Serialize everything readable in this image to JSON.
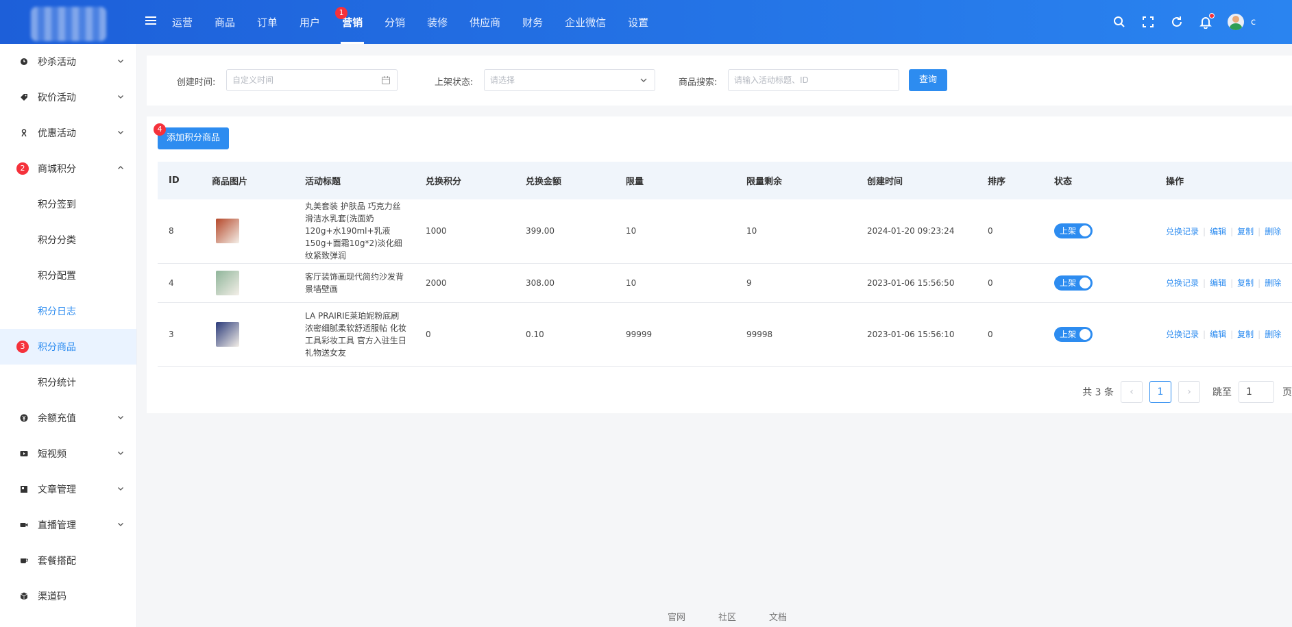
{
  "topbar": {
    "username": "c",
    "nav": [
      {
        "label": "运营",
        "active": false
      },
      {
        "label": "商品",
        "active": false
      },
      {
        "label": "订单",
        "active": false
      },
      {
        "label": "用户",
        "active": false
      },
      {
        "label": "营销",
        "active": true,
        "badge": "1"
      },
      {
        "label": "分销",
        "active": false
      },
      {
        "label": "装修",
        "active": false
      },
      {
        "label": "供应商",
        "active": false
      },
      {
        "label": "财务",
        "active": false
      },
      {
        "label": "企业微信",
        "active": false
      },
      {
        "label": "设置",
        "active": false
      }
    ]
  },
  "sidebar": {
    "items": [
      {
        "label": "秒杀活动",
        "icon": "clock-icon",
        "expandable": true
      },
      {
        "label": "砍价活动",
        "icon": "tag-icon",
        "expandable": true
      },
      {
        "label": "优惠活动",
        "icon": "discount-icon",
        "expandable": true
      },
      {
        "label": "商城积分",
        "icon": "points-icon",
        "expandable": true,
        "expanded": true,
        "badge": "2"
      },
      {
        "label": "积分签到",
        "sub": true
      },
      {
        "label": "积分分类",
        "sub": true
      },
      {
        "label": "积分配置",
        "sub": true
      },
      {
        "label": "积分日志",
        "sub": true,
        "highlight": true
      },
      {
        "label": "积分商品",
        "sub": true,
        "active": true,
        "badge": "3"
      },
      {
        "label": "积分统计",
        "sub": true
      },
      {
        "label": "余额充值",
        "icon": "yen-icon",
        "expandable": true
      },
      {
        "label": "短视频",
        "icon": "video-icon",
        "expandable": true
      },
      {
        "label": "文章管理",
        "icon": "article-icon",
        "expandable": true
      },
      {
        "label": "直播管理",
        "icon": "camera-icon",
        "expandable": true
      },
      {
        "label": "套餐搭配",
        "icon": "cup-icon",
        "expandable": false
      },
      {
        "label": "渠道码",
        "icon": "cube-icon",
        "expandable": false
      }
    ]
  },
  "filters": {
    "created_label": "创建时间:",
    "created_placeholder": "自定义时间",
    "status_label": "上架状态:",
    "status_placeholder": "请选择",
    "search_label": "商品搜索:",
    "search_placeholder": "请输入活动标题、ID",
    "query_button": "查询"
  },
  "list": {
    "add_button": "添加积分商品",
    "add_badge": "4",
    "columns": [
      "ID",
      "商品图片",
      "活动标题",
      "兑换积分",
      "兑换金额",
      "限量",
      "限量剩余",
      "创建时间",
      "排序",
      "状态",
      "操作"
    ],
    "rows": [
      {
        "id": "8",
        "thumb_color": "#b5482a",
        "title": "丸美套装 护肤品 巧克力丝滑洁水乳套(洗面奶120g+水190ml+乳液150g+面霜10g*2)淡化细纹紧致弹润",
        "points": "1000",
        "amount": "399.00",
        "limit": "10",
        "remaining": "10",
        "created": "2024-01-20 09:23:24",
        "sort": "0",
        "status": "上架"
      },
      {
        "id": "4",
        "thumb_color": "#8fb59a",
        "title": "客厅装饰画现代简约沙发背景墙壁画",
        "points": "2000",
        "amount": "308.00",
        "limit": "10",
        "remaining": "9",
        "created": "2023-01-06 15:56:50",
        "sort": "0",
        "status": "上架"
      },
      {
        "id": "3",
        "thumb_color": "#2a3a7a",
        "title": "LA PRAIRIE莱珀妮粉底刷 浓密细腻柔软舒适服帖 化妆工具彩妆工具 官方入驻生日礼物送女友",
        "points": "0",
        "amount": "0.10",
        "limit": "99999",
        "remaining": "99998",
        "created": "2023-01-06 15:56:10",
        "sort": "0",
        "status": "上架"
      }
    ],
    "ops": [
      "兑换记录",
      "编辑",
      "复制",
      "删除"
    ]
  },
  "pager": {
    "total": "共 3 条",
    "current": "1",
    "jump_label": "跳至",
    "jump_value": "1",
    "page_suffix": "页"
  },
  "footer": [
    "官网",
    "社区",
    "文档"
  ],
  "colors": {
    "primary": "#2d8cf0",
    "badge": "#f5313b",
    "topbar_start": "#1d5fd9",
    "topbar_end": "#2a84f0"
  }
}
